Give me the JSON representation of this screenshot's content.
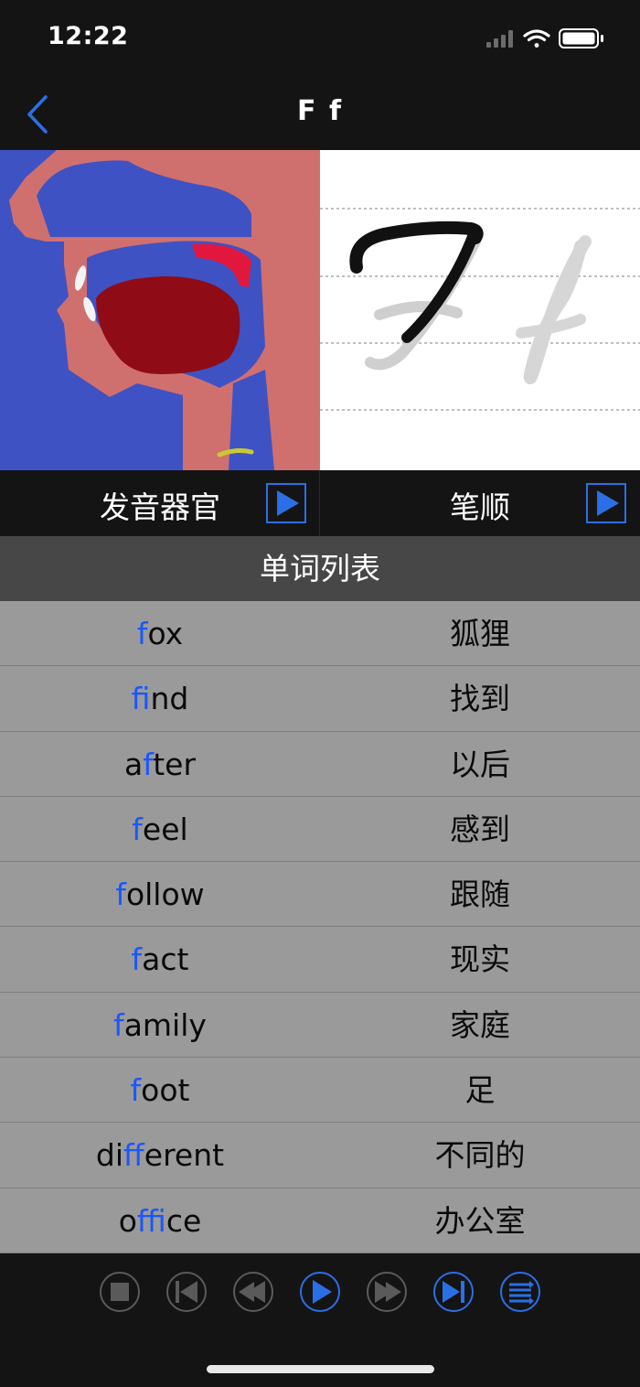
{
  "status_bar": {
    "time": "12:22"
  },
  "nav": {
    "title": "F f",
    "back_icon": "chevron-left-icon"
  },
  "controls": {
    "pronunciation_label": "发音器官",
    "stroke_order_label": "笔顺",
    "play_icon": "play-icon"
  },
  "list": {
    "header": "单词列表",
    "rows": [
      {
        "en_pre": "",
        "en_hl": "f",
        "en_post": "ox",
        "zh": "狐狸"
      },
      {
        "en_pre": "",
        "en_hl": "f",
        "en_post": "ind",
        "zh": "找到"
      },
      {
        "en_pre": "a",
        "en_hl": "f",
        "en_post": "ter",
        "zh": "以后"
      },
      {
        "en_pre": "",
        "en_hl": "f",
        "en_post": "eel",
        "zh": "感到"
      },
      {
        "en_pre": "",
        "en_hl": "f",
        "en_post": "ollow",
        "zh": "跟随"
      },
      {
        "en_pre": "",
        "en_hl": "f",
        "en_post": "act",
        "zh": "现实"
      },
      {
        "en_pre": "",
        "en_hl": "f",
        "en_post": "amily",
        "zh": "家庭"
      },
      {
        "en_pre": "",
        "en_hl": "f",
        "en_post": "oot",
        "zh": "足"
      },
      {
        "en_pre": "di",
        "en_hl": "ff",
        "en_post": "erent",
        "zh": "不同的"
      },
      {
        "en_pre": "o",
        "en_hl": "ff",
        "en_post": "ice",
        "zh": "办公室"
      }
    ]
  },
  "toolbar": {
    "buttons": [
      "stop-icon",
      "skip-to-start-icon",
      "rewind-icon",
      "play-icon",
      "fast-forward-icon",
      "skip-to-end-icon",
      "list-icon"
    ]
  },
  "colors": {
    "accent": "#2b6fe6",
    "highlight": "#1a57ff",
    "row_bg": "#9a9a9a",
    "header_bg": "#474747",
    "background": "#141414"
  }
}
